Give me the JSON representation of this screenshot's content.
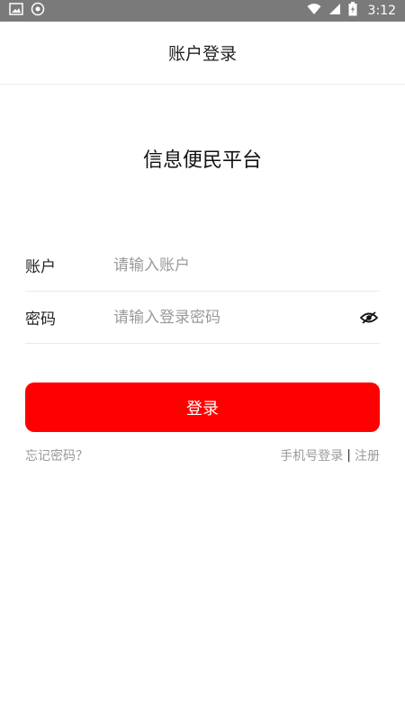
{
  "status_bar": {
    "time": "3:12",
    "left_icons": [
      "image-icon",
      "app-badge-icon"
    ],
    "right_icons": [
      "wifi-icon",
      "signal-icon",
      "battery-icon"
    ]
  },
  "header": {
    "title": "账户登录"
  },
  "app": {
    "name": "信息便民平台"
  },
  "form": {
    "account": {
      "label": "账户",
      "placeholder": "请输入账户",
      "value": ""
    },
    "password": {
      "label": "密码",
      "placeholder": "请输入登录密码",
      "value": "",
      "toggle_icon": "eye-icon"
    }
  },
  "actions": {
    "login_label": "登录",
    "forgot_password": "忘记密码？",
    "phone_login": "手机号登录",
    "divider": "|",
    "register": "注册"
  },
  "colors": {
    "accent": "#ff0000",
    "status_bar": "#7a7a7a",
    "muted_text": "#999999"
  }
}
